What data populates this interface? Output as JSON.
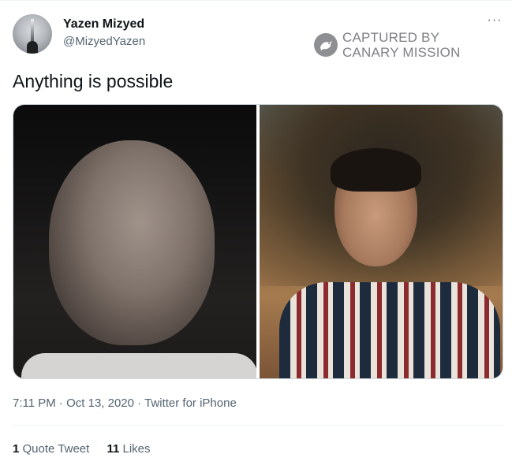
{
  "author": {
    "display_name": "Yazen Mizyed",
    "handle": "@MizyedYazen",
    "avatar_icon": "profile-photo"
  },
  "menu": {
    "more_icon": "more-options-icon",
    "more_label": "···"
  },
  "watermark": {
    "line1": "CAPTURED BY",
    "line2": "CANARY MISSION",
    "icon": "canary-bird-icon"
  },
  "tweet": {
    "text": "Anything is possible",
    "media_count": 2
  },
  "meta": {
    "time": "7:11 PM",
    "separator1": " · ",
    "date": "Oct 13, 2020",
    "separator2": " · ",
    "source": "Twitter for iPhone"
  },
  "stats": {
    "quote_count": "1",
    "quote_label": "Quote Tweet",
    "likes_count": "11",
    "likes_label": "Likes"
  }
}
